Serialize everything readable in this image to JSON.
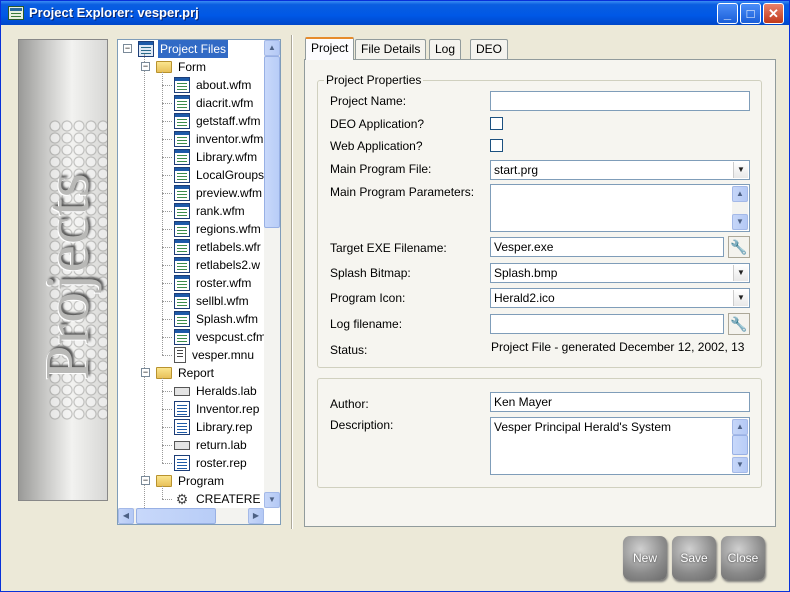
{
  "window": {
    "title": "Project Explorer: vesper.prj"
  },
  "titlebar_buttons": {
    "minimize": "_",
    "maximize": "□",
    "close": "✕"
  },
  "side_image": {
    "text": "Projects"
  },
  "tree": {
    "root": "Project Files",
    "groups": [
      {
        "label": "Form",
        "items": [
          "about.wfm",
          "diacrit.wfm",
          "getstaff.wfm",
          "inventor.wfm",
          "Library.wfm",
          "LocalGroups",
          "preview.wfm",
          "rank.wfm",
          "regions.wfm",
          "retlabels.wfr",
          "retlabels2.w",
          "roster.wfm",
          "sellbl.wfm",
          "Splash.wfm",
          "vespcust.cfm",
          "vesper.mnu"
        ]
      },
      {
        "label": "Report",
        "items": [
          "Heralds.lab",
          "Inventor.rep",
          "Library.rep",
          "return.lab",
          "roster.rep"
        ]
      },
      {
        "label": "Program",
        "items": [
          "CREATERE"
        ]
      }
    ]
  },
  "tabs": [
    "Project",
    "File Details",
    "Log",
    "DEO"
  ],
  "project": {
    "group_title": "Project Properties",
    "project_name_label": "Project Name:",
    "project_name_value": "",
    "deo_label": "DEO Application?",
    "web_label": "Web Application?",
    "main_program_label": "Main Program File:",
    "main_program_value": "start.prg",
    "params_label": "Main Program Parameters:",
    "params_value": "",
    "exe_label": "Target EXE Filename:",
    "exe_value": "Vesper.exe",
    "splash_label": "Splash Bitmap:",
    "splash_value": "Splash.bmp",
    "icon_label": "Program Icon:",
    "icon_value": "Herald2.ico",
    "log_label": "Log filename:",
    "log_value": "",
    "status_label": "Status:",
    "status_value": "Project File - generated December 12, 2002, 13"
  },
  "author": {
    "author_label": "Author:",
    "author_value": "Ken Mayer",
    "description_label": "Description:",
    "description_value": "Vesper Principal Herald's System"
  },
  "buttons": {
    "new": "New",
    "save": "Save",
    "close": "Close"
  },
  "icons": {
    "wrench": "🔧",
    "combo_arrow": "▼",
    "scroll_up": "▲",
    "scroll_down": "▼",
    "scroll_left": "◀",
    "scroll_right": "▶"
  }
}
